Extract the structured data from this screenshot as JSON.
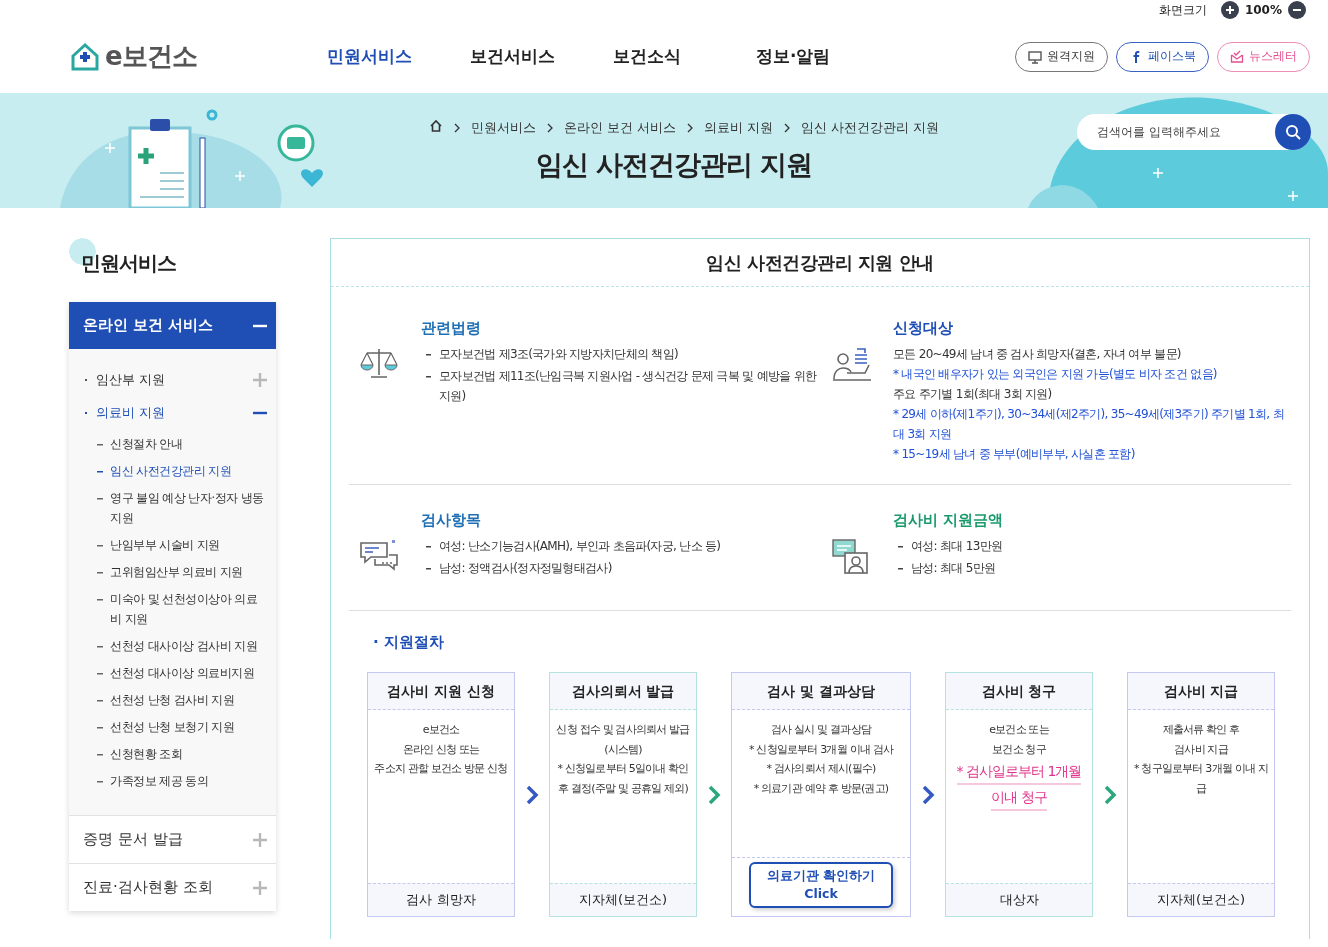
{
  "utility": {
    "label": "화면크기",
    "zoom": "100%"
  },
  "header": {
    "logo": "e보건소",
    "nav": [
      {
        "label": "민원서비스",
        "selected": true
      },
      {
        "label": "보건서비스",
        "selected": false
      },
      {
        "label": "보건소식",
        "selected": false
      },
      {
        "label": "정보·알림",
        "selected": false
      }
    ],
    "links": [
      {
        "label": "원격지원",
        "kind": "remote"
      },
      {
        "label": "페이스북",
        "kind": "facebook"
      },
      {
        "label": "뉴스레터",
        "kind": "newsletter"
      }
    ]
  },
  "banner": {
    "breadcrumb": [
      "민원서비스",
      "온라인 보건 서비스",
      "의료비 지원",
      "임신 사전건강관리 지원"
    ],
    "title": "임신 사전건강관리 지원",
    "search": {
      "placeholder": "검색어를 입력해주세요"
    }
  },
  "sidebar": {
    "title": "민원서비스",
    "groups": [
      {
        "label": "온라인 보건 서비스",
        "expanded": true,
        "children": [
          {
            "label": "임산부 지원",
            "expanded": false,
            "selected": false
          },
          {
            "label": "의료비 지원",
            "expanded": true,
            "selected": true,
            "children": [
              {
                "label": "신청절차 안내",
                "selected": false
              },
              {
                "label": "임신 사전건강관리 지원",
                "selected": true
              },
              {
                "label": "영구 불임 예상 난자·정자 냉동 지원",
                "selected": false
              },
              {
                "label": "난임부부 시술비 지원",
                "selected": false
              },
              {
                "label": "고위험임산부 의료비 지원",
                "selected": false
              },
              {
                "label": "미숙아 및 선천성이상아 의료비 지원",
                "selected": false
              },
              {
                "label": "선천성 대사이상 검사비 지원",
                "selected": false
              },
              {
                "label": "선천성 대사이상 의료비지원",
                "selected": false
              },
              {
                "label": "선천성 난청 검사비 지원",
                "selected": false
              },
              {
                "label": "선천성 난청 보청기 지원",
                "selected": false
              },
              {
                "label": "신청현황 조회",
                "selected": false
              },
              {
                "label": "가족정보 제공 동의",
                "selected": false
              }
            ]
          }
        ]
      },
      {
        "label": "증명 문서 발급",
        "expanded": false
      },
      {
        "label": "진료·검사현황 조회",
        "expanded": false
      }
    ]
  },
  "content": {
    "title": "임신 사전건강관리 지원 안내",
    "sections": [
      {
        "heading": "관련법령",
        "color": "#1f6fb5",
        "lines": [
          {
            "kind": "bullet",
            "text": "모자보건법 제3조(국가와 지방자치단체의 책임)"
          },
          {
            "kind": "bullet",
            "text": "모자보건법 제11조(난임극복 지원사업 - 생식건강 문제 극복 및 예방을 위한 지원)"
          }
        ]
      },
      {
        "heading": "신청대상",
        "color": "#1f4fb5",
        "lines": [
          {
            "kind": "plain",
            "text": "모든 20~49세 남녀 중 검사 희망자(결혼, 자녀 여부 불문)"
          },
          {
            "kind": "note",
            "text": "* 내국인 배우자가 있는 외국인은 지원 가능(별도 비자 조건 없음)"
          },
          {
            "kind": "plain",
            "text": "주요 주기별 1회(최대 3회 지원)"
          },
          {
            "kind": "note",
            "text": "* 29세 이하(제1주기), 30~34세(제2주기), 35~49세(제3주기) 주기별 1회, 최대 3회 지원"
          },
          {
            "kind": "note",
            "text": "* 15~19세 남녀 중 부부(예비부부, 사실혼 포함)"
          }
        ]
      },
      {
        "heading": "검사항목",
        "color": "#1f6fb5",
        "lines": [
          {
            "kind": "bullet",
            "text": "여성: 난소기능검사(AMH), 부인과 초음파(자궁, 난소 등)"
          },
          {
            "kind": "bullet",
            "text": "남성: 정액검사(정자정밀형태검사)"
          }
        ]
      },
      {
        "heading": "검사비 지원금액",
        "color": "#1a9a6c",
        "lines": [
          {
            "kind": "bullet",
            "text": "여성: 최대 13만원"
          },
          {
            "kind": "bullet",
            "text": "남성: 최대 5만원"
          }
        ]
      }
    ],
    "procedure": {
      "heading": "· 지원절차",
      "steps": [
        {
          "title": "검사비 지원 신청",
          "color": "#c5c8f0",
          "lines": [
            {
              "kind": "plain",
              "text": "e보건소"
            },
            {
              "kind": "plain",
              "text": "온라인 신청 또는"
            },
            {
              "kind": "plain",
              "text": "주소지 관할 보건소 방문 신청"
            }
          ],
          "actor": "검사 희망자"
        },
        {
          "title": "검사의뢰서 발급",
          "color": "#b5e3e0",
          "lines": [
            {
              "kind": "plain",
              "text": "신청 접수 및 검사의뢰서 발급 (시스템)"
            },
            {
              "kind": "plain",
              "text": "* 신청일로부터 5일이내 확인 후 결정(주말 및 공휴일 제외)"
            }
          ],
          "actor": "지자체(보건소)"
        },
        {
          "title": "검사 및 결과상담",
          "color": "#c5c8f0",
          "lines": [
            {
              "kind": "plain",
              "text": "검사 실시 및 결과상담"
            },
            {
              "kind": "plain",
              "text": "* 신청일로부터 3개월 이내 검사"
            },
            {
              "kind": "plain",
              "text": "* 검사의뢰서 제시(필수)"
            },
            {
              "kind": "plain",
              "text": "* 의료기관 예약 후 방문(권고)"
            }
          ],
          "button": [
            "의료기관 확인하기",
            "Click"
          ]
        },
        {
          "title": "검사비 청구",
          "color": "#b5e3e0",
          "lines": [
            {
              "kind": "plain",
              "text": "e보건소 또는"
            },
            {
              "kind": "plain",
              "text": "보건소 청구"
            },
            {
              "kind": "highlight",
              "text": "* 검사일로부터 1개월"
            },
            {
              "kind": "highlight",
              "text": "이내 청구"
            }
          ],
          "actor": "대상자"
        },
        {
          "title": "검사비 지급",
          "color": "#c5c8f0",
          "lines": [
            {
              "kind": "plain",
              "text": "제출서류 확인 후"
            },
            {
              "kind": "plain",
              "text": "검사비 지급"
            },
            {
              "kind": "plain",
              "text": "* 청구일로부터 3개월 이내 지급"
            }
          ],
          "actor": "지자체(보건소)"
        }
      ],
      "arrows": [
        {
          "color": "#3458c4"
        },
        {
          "color": "#2aa77f"
        },
        {
          "color": "#3458c4"
        },
        {
          "color": "#2aa77f"
        }
      ]
    }
  }
}
